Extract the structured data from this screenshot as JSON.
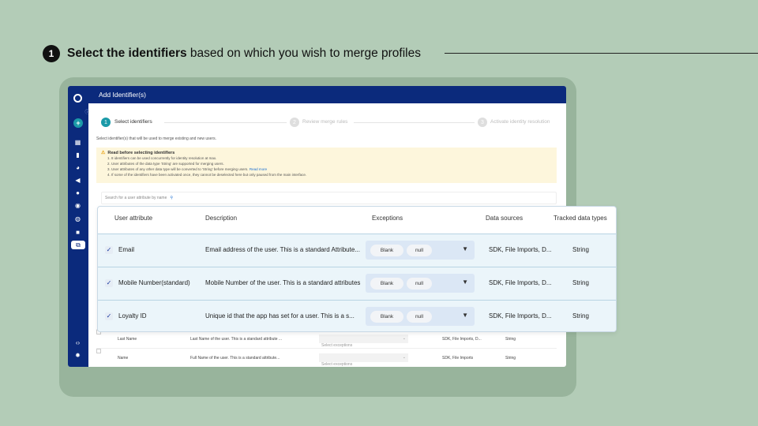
{
  "step": {
    "number": "1",
    "bold": "Select the identifiers",
    "rest": " based on which you wish to merge profiles"
  },
  "topbar": {
    "title": "Add Identifier(s)"
  },
  "stepper": [
    {
      "num": "1",
      "label": "Select identifiers",
      "active": true
    },
    {
      "num": "2",
      "label": "Review merge rules",
      "active": false
    },
    {
      "num": "3",
      "label": "Activate identity resolution",
      "active": false
    }
  ],
  "subtitle": "Select identifier(s) that will be used to merge existing and new users.",
  "notice": {
    "heading": "Read before selecting identifiers",
    "items": [
      "1.   8 identifiers can be used concurrently for identity resolution at max.",
      "2.   User attributes of the data type 'String' are supported for merging users.",
      "3.   User attributes of any other data type will be converted to 'String' before merging users.",
      "4.   If some of the identifiers have been activated once, they cannot be deselected here but only paused from the main interface."
    ],
    "read_more": "Read more"
  },
  "search": {
    "placeholder": "Search for a user attribute by name"
  },
  "table": {
    "headers": {
      "attribute": "User attribute",
      "description": "Description",
      "exceptions": "Exceptions",
      "sources": "Data sources",
      "types": "Tracked data types"
    },
    "selected_rows": [
      {
        "name": "Email",
        "description": "Email address of the user. This is a standard Attribute...",
        "chips": [
          "Blank",
          "null"
        ],
        "sources": "SDK, File Imports, D...",
        "type": "String",
        "checked": true
      },
      {
        "name": "Mobile Number(standard)",
        "description": "Mobile Number of the user. This is a standard attributes",
        "chips": [
          "Blank",
          "null"
        ],
        "sources": "SDK, File Imports, D...",
        "type": "String",
        "checked": true
      },
      {
        "name": "Loyalty ID",
        "description": "Unique id that the app has set for a user. This is a s...",
        "chips": [
          "Blank",
          "null"
        ],
        "sources": "SDK, File Imports, D...",
        "type": "String",
        "checked": true
      }
    ],
    "other_rows": [
      {
        "name": "Last Name",
        "description": "Last Name of the user. This is a standard attribute ...",
        "exceptions": "Select exceptions",
        "sources": "SDK, File Imports, D...",
        "type": "String"
      },
      {
        "name": "Name",
        "description": "Full Name of the user. This is a standard attribute...",
        "exceptions": "Select exceptions",
        "sources": "SDK, File Imports",
        "type": "String"
      }
    ]
  },
  "colors": {
    "navy": "#0b2a7c",
    "teal": "#1b9aa8",
    "background": "#b3ccb7"
  },
  "icons": [
    "logo-icon",
    "add-icon",
    "dashboard-icon",
    "analytics-icon",
    "segment-icon",
    "campaign-icon",
    "flow-icon",
    "user-icon",
    "message-icon",
    "content-icon",
    "identity-icon",
    "code-icon",
    "settings-icon"
  ]
}
